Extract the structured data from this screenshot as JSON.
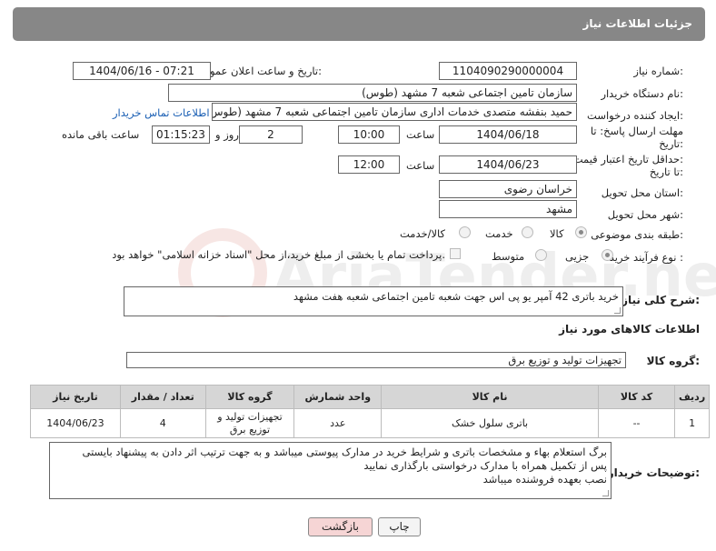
{
  "header": {
    "title": "جزئیات اطلاعات نیاز"
  },
  "need_number": {
    "label": "شماره نیاز:",
    "value": "1104090290000004"
  },
  "announce_datetime": {
    "label": "تاریخ و ساعت اعلان عمومی:",
    "value": "1404/06/16 - 07:21"
  },
  "buyer_org": {
    "label": "نام دستگاه خریدار:",
    "value": "سازمان تامین اجتماعی شعبه 7 مشهد (طوس)"
  },
  "creator": {
    "label": "ایجاد کننده درخواست:",
    "value": "حمید بنفشه متصدی خدمات اداری سازمان تامین اجتماعی شعبه 7 مشهد (طوس)",
    "contact_link": "اطلاعات تماس خریدار"
  },
  "reply_deadline": {
    "label_line1": "مهلت ارسال پاسخ: تا",
    "label_line2": "تاریخ:",
    "date": "1404/06/18",
    "time_label": "ساعت",
    "time": "10:00",
    "days": "2",
    "days_label": "روز و",
    "remaining": "01:15:23",
    "remaining_label": "ساعت باقی مانده"
  },
  "price_validity": {
    "label_line1": "حداقل تاریخ اعتبار قیمت:",
    "label_line2": "تا تاریخ:",
    "date": "1404/06/23",
    "time_label": "ساعت",
    "time": "12:00"
  },
  "province": {
    "label": "استان محل تحویل:",
    "value": "خراسان رضوی"
  },
  "city": {
    "label": "شهر محل تحویل:",
    "value": "مشهد"
  },
  "category": {
    "label": "طبقه بندی موضوعی:",
    "options": [
      "کالا",
      "خدمت",
      "کالا/خدمت"
    ],
    "selected": "کالا"
  },
  "purchase_process": {
    "label": "نوع فرآیند خرید :",
    "options": [
      "جزیی",
      "متوسط"
    ],
    "selected": "جزیی",
    "payment_note": "پرداخت تمام یا بخشی از مبلغ خرید،از محل \"اسناد خزانه اسلامی\" خواهد بود."
  },
  "description": {
    "label": "شرح کلی نیاز:",
    "value": "خرید باتری 42 آمپر یو پی اس جهت شعبه تامین اجتماعی شعبه هفت مشهد"
  },
  "goods_info": {
    "title": "اطلاعات کالاهای مورد نیاز"
  },
  "goods_group": {
    "label": "گروه کالا:",
    "value": "تجهیزات تولید و توزیع برق"
  },
  "table": {
    "headers": [
      "ردیف",
      "کد کالا",
      "نام کالا",
      "واحد شمارش",
      "گروه کالا",
      "تعداد / مقدار",
      "تاریخ نیاز"
    ],
    "rows": [
      [
        "1",
        "--",
        "باتری سلول خشک",
        "عدد",
        "تجهیزات تولید و توزیع برق",
        "4",
        "1404/06/23"
      ]
    ]
  },
  "buyer_notes": {
    "label": "توضیحات خریدار:",
    "lines": [
      "برگ استعلام بهاء و مشخصات باتری و شرایط خرید در مدارک پیوستی میباشد و به جهت ترتیب اثر دادن به پیشنهاد بایستی",
      "پس از تکمیل همراه با مدارک درخواستی بارگذاری نمایید",
      "نصب بعهده فروشنده میباشد"
    ]
  },
  "buttons": {
    "print": "چاپ",
    "back": "بازگشت"
  },
  "watermark": {
    "text": "AriaTender.net"
  },
  "colors": {
    "header_bg": "#878787",
    "table_header_bg": "#d6d6d6",
    "link": "#1a5fb4",
    "back_button_bg": "#f6d5d5"
  }
}
